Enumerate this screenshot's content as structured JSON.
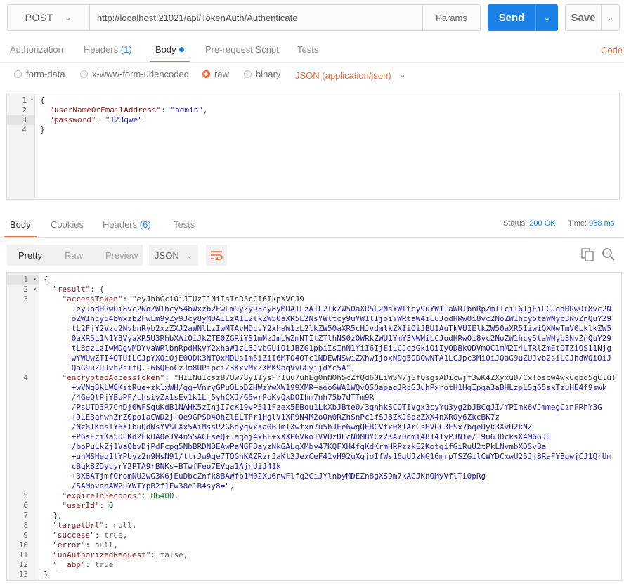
{
  "request": {
    "method": "POST",
    "url": "http://localhost:21021/api/TokenAuth/Authenticate",
    "params_label": "Params",
    "send_label": "Send",
    "save_label": "Save"
  },
  "request_tabs": [
    {
      "label": "Authorization",
      "count": ""
    },
    {
      "label": "Headers",
      "count": "(1)"
    },
    {
      "label": "Body",
      "count": ""
    },
    {
      "label": "Pre-request Script",
      "count": ""
    },
    {
      "label": "Tests",
      "count": ""
    }
  ],
  "code_label": "Code",
  "body_modes": [
    "form-data",
    "x-www-form-urlencoded",
    "raw",
    "binary"
  ],
  "body_mode_selected": "raw",
  "content_type": "JSON (application/json)",
  "request_body_lines": [
    "{",
    "  \"userNameOrEmailAddress\": \"admin\",",
    "  \"password\": \"123qwe\"",
    "}"
  ],
  "response_tabs": [
    {
      "label": "Body",
      "count": ""
    },
    {
      "label": "Cookies",
      "count": ""
    },
    {
      "label": "Headers",
      "count": "(6)"
    },
    {
      "label": "Tests",
      "count": ""
    }
  ],
  "response_status": {
    "status_label": "Status:",
    "status_value": "200 OK",
    "time_label": "Time:",
    "time_value": "958 ms"
  },
  "view_modes": [
    "Pretty",
    "Raw",
    "Preview"
  ],
  "view_mode_selected": "Pretty",
  "format": "JSON",
  "response_lines": [
    {
      "n": "1",
      "t": "{"
    },
    {
      "n": "2",
      "t": "  \"result\": {"
    },
    {
      "n": "3",
      "t": "    \"accessToken\": \"eyJhbGciOiJIUzI1NiIsInR5cCI6IkpXVCJ9"
    },
    {
      "n": "",
      "t": "      .eyJodHRwOi8vc2NoZW1hcy54bWxzb2FwLm9yZy93cy8yMDA1LzA1L2lkZW50aXR5L2NsYWltcy9uYW1laWRlbnRpZmllciI6IjEiLCJodHRwOi8vc2N"
    },
    {
      "n": "",
      "t": "      oZW1hcy54bWxzb2FwLm9yZy93cy8yMDA1LzA1L2lkZW50aXR5L2NsYWltcy9uYW1lIjoiYWRtaW4iLCJodHRwOi8vc2NoZW1hcy5taWNyb3NvZnQuY29"
    },
    {
      "n": "",
      "t": "      tL2FjY2Vzc2NvbnRyb2xzZXJ2aWNlLzIwMTAvMDcvY2xhaW1zL2lkZW50aXR5cHJvdmlkZXIiOiJBU1AuTkVUIElkZW50aXR5IiwiQXNwTmV0LklkZW5"
    },
    {
      "n": "",
      "t": "      0aXR5L1N1Y3VyaXR5U3RhbXAiOiJkZTE0ZGRiYS1mMzJmLWZmNTItZTlhNS0zOWRkZWU1YmY3NWMiLCJodHRwOi8vc2NoZW1hcy5taWNyb3NvZnQuY29"
    },
    {
      "n": "",
      "t": "      tL3dzLzIwMDgvMDYvaWRlbnRpdHkvY2xhaW1zL3JvbGUiOiJBZG1pbiIsInN1YiI6IjEiLCJqdGkiOiIyODBkODVmOC1mM2I4LTRlZmEtOTZiOS11Njg"
    },
    {
      "n": "",
      "t": "      wYWUwZTI4OTUiLCJpYXQiOjE0ODk3NTQxMDUsIm5iZiI6MTQ4OTc1NDEwNSwiZXhwIjoxNDg5ODQwNTA1LCJpc3MiOiJQaG9uZUJvb2siLCJhdWQiOiJ"
    },
    {
      "n": "",
      "t": "      QaG9uZUJvb2sifQ.-66QEoCzJm8UPipciZ3KxvMxZXMK9pqVvGGyijdYc5A\","
    },
    {
      "n": "4",
      "t": "    \"encryptedAccessToken\": \"HIINu1cszB7Ow78y11ysFr1uu7uhEg0nNOh5cZfQd60LiWSN7jSfQsgsADicwjf3wK4ZXyxuD/CxTosbw4wkCqbq5gCluT"
    },
    {
      "n": "",
      "t": "      +wVNg8kLW8KstRue+zklxWH/gg+VnryGPuOLpDZHWzYwXW199XMR+aeo6WA1WQvQSOapagJRcGJuhPxrotH1HgIpqa3aBHLzpLSq65skTzuHE4f9swk"
    },
    {
      "n": "",
      "t": "      /4GeQtPjYBuPF/chsiyZx1sEv1k1Lj5yhCXJ/G5wrPoKvQxDOIhm7nh75b7dTTm9R"
    },
    {
      "n": "",
      "t": "      /PsUTD3R7CnDj0WFSquKdB1NAHK5zInjI7cK19vP511Fzex5EBou1LkXbJBte0/3qnhkSCOTIVgx3cyYu3yg2bJBCqJI/YPImk6VJmmegCznFRhY3G"
    },
    {
      "n": "",
      "t": "      +9LE3ahwhZrZ0poiaCWD2j+Qe9GPSD4QhZlELTFr1HglV1XP9N4M2oOn0RZhSnPc1fSJ8ZKJSqzZXX4nXRQy6ZkcBK7z"
    },
    {
      "n": "",
      "t": "      /Nz6IKqsTY6XTbuQdNsYVSLXx5AiMssP2G6dyqVxXa0BJmTXwfxn7u5hJEe6wqQEBCVfx0X1ArCsHVGC3ESx7bqeDyk3XvU2kNZ"
    },
    {
      "n": "",
      "t": "      +P6sEciKa5OLKd2FkOA0eJV4nSSACEseQ+Jaqoj4xBF+xXXPGVko1VVUzDLcNDM8YCz2KA70dmI48141yPJN1e/19u63DcksX4M6GJU"
    },
    {
      "n": "",
      "t": "      /boPuLkZj1Va0bvDjPdFcpg5NbBRDNDEAwPaNGF8ayzNkGALqXMby47KQFXH4fgKdKrmHRPzzkE2KotgifGiRuU2tPkLNvmbXDSvBa"
    },
    {
      "n": "",
      "t": "      +unMSHeg1tYPUyz2n9HsN91/ttrJw9qe7TQGnKAZRzrJaKt3JexCeF41yH92uXgjoIfWs16gUJzNG16mrpTSZGilCWYDCxwU25Jj8RaFY8gwjCJ1QrUm"
    },
    {
      "n": "",
      "t": "      cBqk8ZDycyrY2PTA9rBNKs+BTwfFeo7EVqa1AjnUiJ41k"
    },
    {
      "n": "",
      "t": "      +3X8ATjmfOromNU2wG3K6jEuDbcZnfk8BAWfb1M02Xu6nwFlfq2CiJYlnbyMDEZn8gXS9m7kACJKnQMyVflTi0pRg"
    },
    {
      "n": "",
      "t": "      /SAMbvenAW2uYWIYpB2f1Fw38e1B4sy8=\","
    },
    {
      "n": "5",
      "t": "    \"expireInSeconds\": 86400,"
    },
    {
      "n": "6",
      "t": "    \"userId\": 0"
    },
    {
      "n": "7",
      "t": "  },"
    },
    {
      "n": "8",
      "t": "  \"targetUrl\": null,"
    },
    {
      "n": "9",
      "t": "  \"success\": true,"
    },
    {
      "n": "10",
      "t": "  \"error\": null,"
    },
    {
      "n": "11",
      "t": "  \"unAuthorizedRequest\": false,"
    },
    {
      "n": "12",
      "t": "  \"__abp\": true"
    },
    {
      "n": "13",
      "t": "}"
    }
  ],
  "colors": {
    "accent_orange": "#f26b3a",
    "send_blue": "#1c81e6",
    "json_key": "#8b1c1c",
    "json_string": "#1a1aa6",
    "json_number": "#1a7a3a"
  }
}
